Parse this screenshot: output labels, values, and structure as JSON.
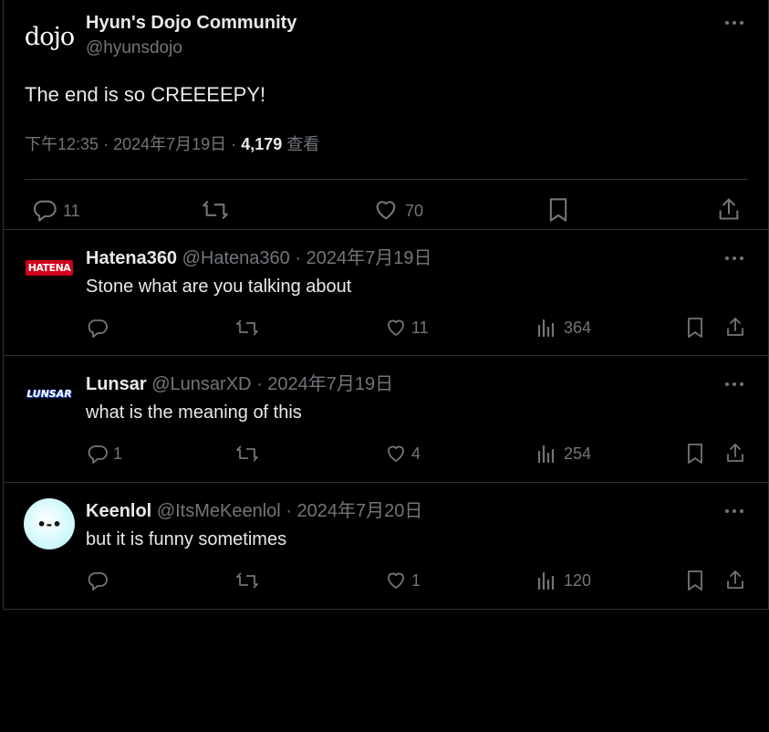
{
  "main_post": {
    "display_name": "Hyun's Dojo Community",
    "handle": "@hyunsdojo",
    "text": "The end is so CREEEEPY!",
    "time": "下午12:35",
    "sep1": "·",
    "date": "2024年7月19日",
    "sep2": "·",
    "views": "4,179",
    "views_label": "查看",
    "stats": {
      "replies": "11",
      "likes": "70"
    },
    "avatar_text": "dojo"
  },
  "replies": [
    {
      "display_name": "Hatena360",
      "handle": "@Hatena360",
      "sep": "·",
      "date": "2024年7月19日",
      "text": "Stone what are you talking about",
      "replies": "",
      "likes": "11",
      "views": "364",
      "avatar_text": "HATENA"
    },
    {
      "display_name": "Lunsar",
      "handle": "@LunsarXD",
      "sep": "·",
      "date": "2024年7月19日",
      "text": "what is the meaning of this",
      "replies": "1",
      "likes": "4",
      "views": "254",
      "avatar_text": "LUNSAR"
    },
    {
      "display_name": "Keenlol",
      "handle": "@ItsMeKeenlol",
      "sep": "·",
      "date": "2024年7月20日",
      "text": "but it is funny sometimes",
      "replies": "",
      "likes": "1",
      "views": "120",
      "avatar_text": "•-•"
    }
  ],
  "colors": {
    "background": "#000000",
    "text": "#e7e9ea",
    "muted": "#71767b",
    "border": "#2f3336",
    "hatena_red": "#d0021b",
    "lunsar_blue": "#1d4ed8",
    "keenlol_avatar": "#c9f7fb"
  }
}
